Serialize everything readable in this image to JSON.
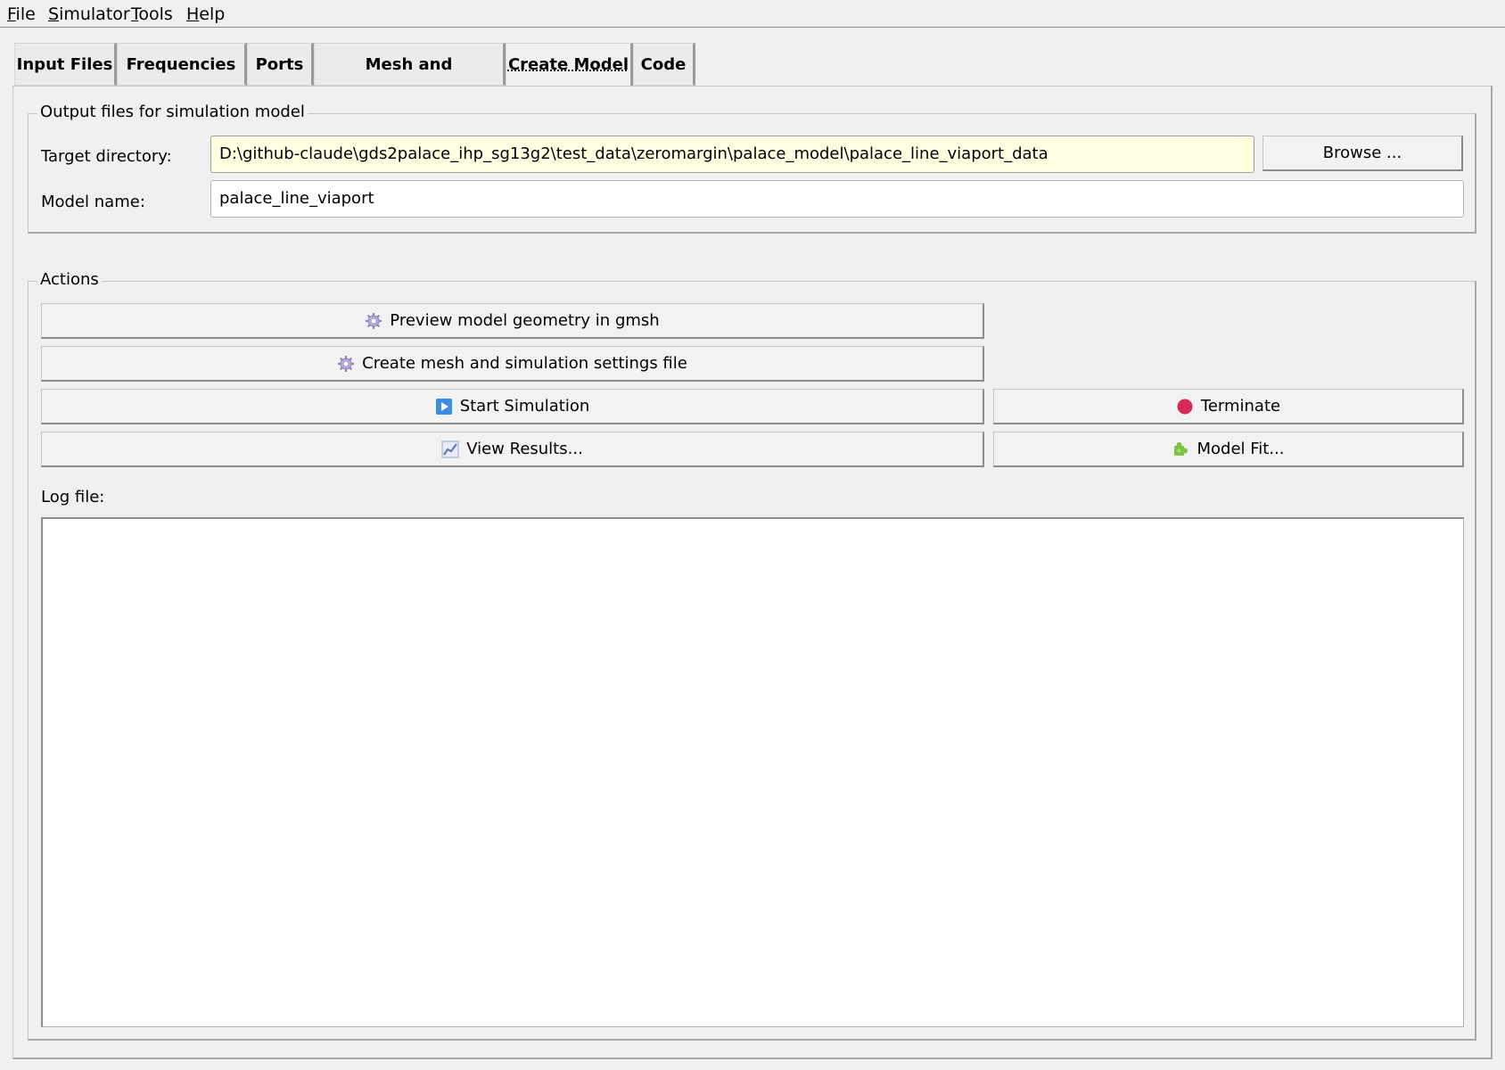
{
  "menubar": {
    "file": {
      "acc": "F",
      "rest": "ile"
    },
    "simulator": {
      "acc": "S",
      "rest": "imulator"
    },
    "tools": {
      "acc": "T",
      "rest": "ools"
    },
    "help": {
      "acc": "H",
      "rest": "elp"
    }
  },
  "tabs": [
    {
      "label": "Input Files",
      "active": false
    },
    {
      "label": "Frequencies",
      "active": false
    },
    {
      "label": "Ports",
      "active": false
    },
    {
      "label": "Mesh and Boundaries",
      "active": false
    },
    {
      "label": "Create Model",
      "active": true
    },
    {
      "label": "Code",
      "active": false
    }
  ],
  "output_group": {
    "title": "Output files for simulation model",
    "target_dir_label": "Target directory:",
    "target_dir_value": "D:\\github-claude\\gds2palace_ihp_sg13g2\\test_data\\zeromargin\\palace_model\\palace_line_viaport_data",
    "browse_label": "Browse ...",
    "model_name_label": "Model name:",
    "model_name_value": "palace_line_viaport"
  },
  "actions_group": {
    "title": "Actions",
    "preview_label": "Preview model geometry in gmsh",
    "preview_icon": "gear-icon",
    "create_mesh_label": "Create mesh and simulation settings file",
    "create_mesh_icon": "gear-icon",
    "start_label": "Start Simulation",
    "start_icon": "play-icon",
    "terminate_label": "Terminate",
    "terminate_icon": "stop-icon",
    "view_results_label": "View Results...",
    "view_results_icon": "chart-icon",
    "model_fit_label": "Model Fit...",
    "model_fit_icon": "puzzle-icon",
    "log_label": "Log file:",
    "log_content": ""
  },
  "colors": {
    "background": "#f0f0f0",
    "highlight_field": "#ffffe1",
    "terminate_red": "#d8285a",
    "play_blue": "#3a8ee6"
  }
}
